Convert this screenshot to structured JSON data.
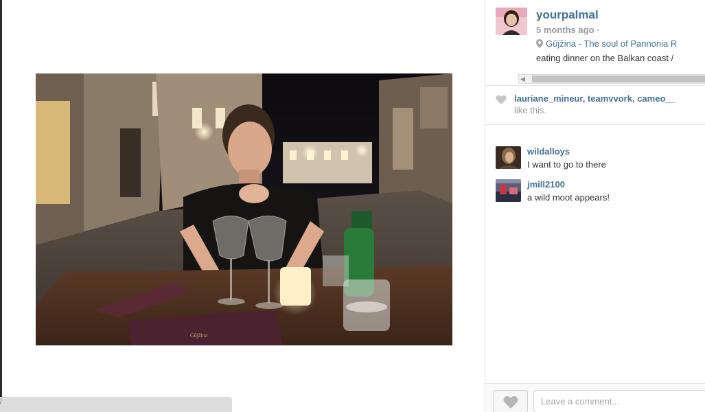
{
  "post": {
    "username": "yourpalmal",
    "time": "5 months ago ·",
    "location": "Gûjžina - The soul of Pannonia R",
    "caption": "eating dinner on the Balkan coast /"
  },
  "likes": {
    "likers": "lauriane_mineur, teamvvork, cameo__",
    "text": "like this."
  },
  "comments": [
    {
      "user": "wildalloys",
      "text": "I want to go to there"
    },
    {
      "user": "jmill2100",
      "text": "a wild moot appears!"
    }
  ],
  "footer": {
    "comment_placeholder": "Leave a comment..."
  },
  "photo": {
    "menu_cover_text": "Gûjžina"
  },
  "colors": {
    "link": "#3f729b",
    "muted": "#9a9a9a"
  },
  "icons": [
    "map-pin-icon",
    "heart-icon"
  ]
}
